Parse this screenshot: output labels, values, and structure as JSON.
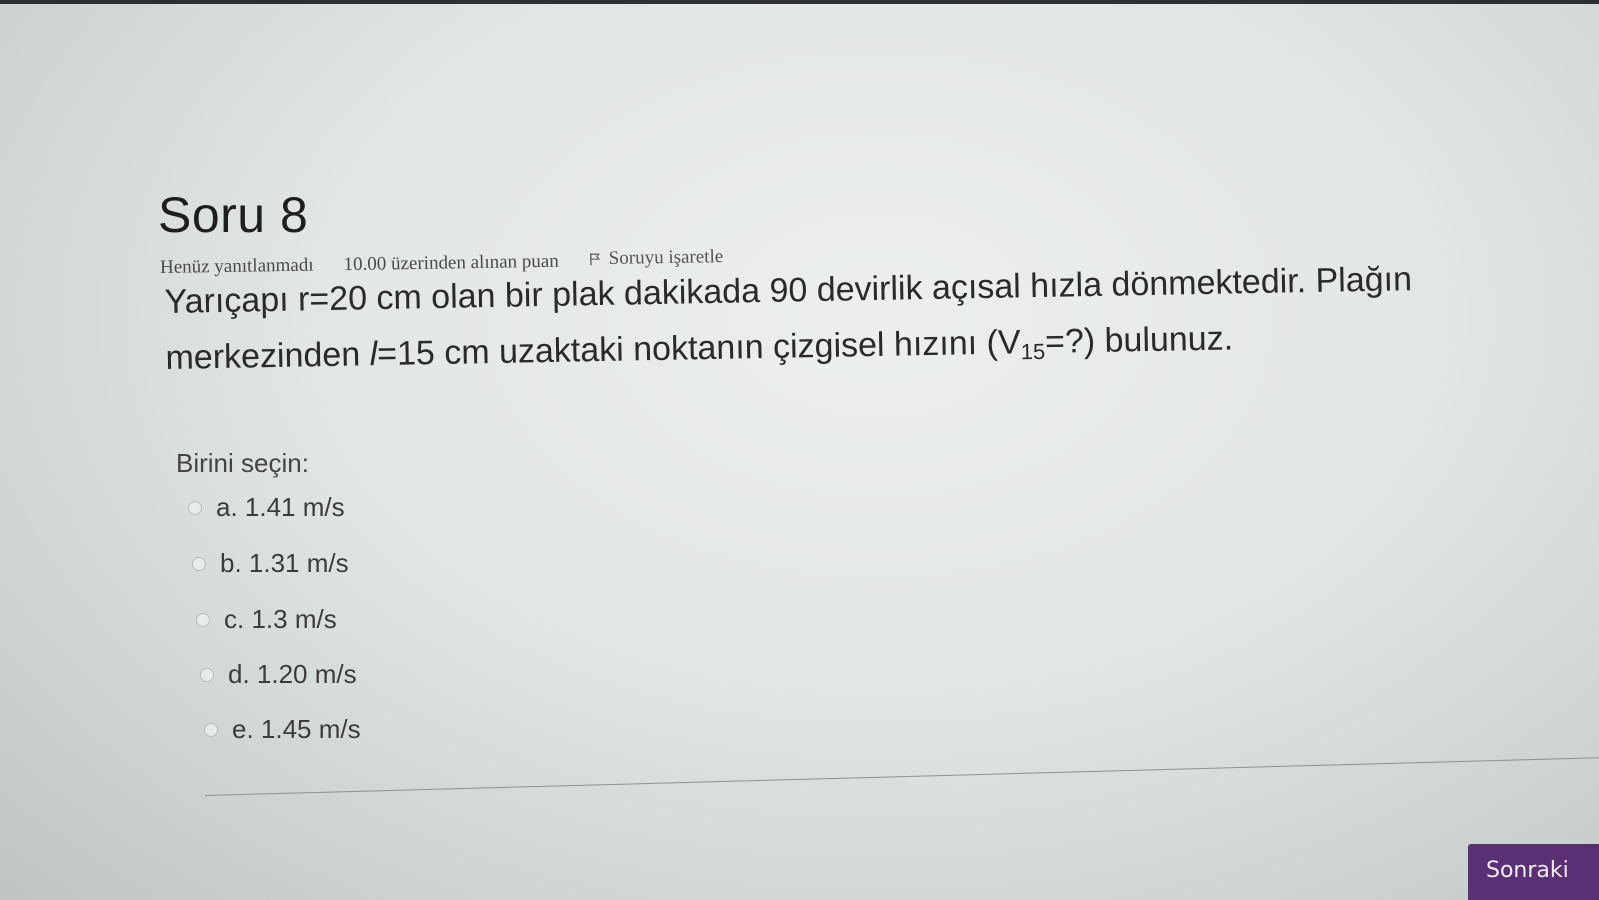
{
  "question": {
    "title": "Soru 8",
    "status": "Henüz yanıtlanmadı",
    "points": "10.00 üzerinden alınan puan",
    "flag_label": "Soruyu işaretle",
    "text_line1": "Yarıçapı r=20 cm olan bir plak dakikada 90 devirlik açısal hızla dönmektedir. Plağın",
    "text_line2_a": "merkezinden ",
    "text_line2_var": "l",
    "text_line2_b": "=15 cm  uzaktaki noktanın çizgisel hızını (V",
    "text_line2_sub": "15",
    "text_line2_c": "=?) bulunuz.",
    "prompt": "Birini seçin:",
    "options": [
      {
        "label": "a. 1.41 m/s"
      },
      {
        "label": "b. 1.31 m/s"
      },
      {
        "label": "c. 1.3 m/s"
      },
      {
        "label": "d. 1.20 m/s"
      },
      {
        "label": "e. 1.45 m/s"
      }
    ]
  },
  "navigation": {
    "next_label": "Sonraki"
  }
}
